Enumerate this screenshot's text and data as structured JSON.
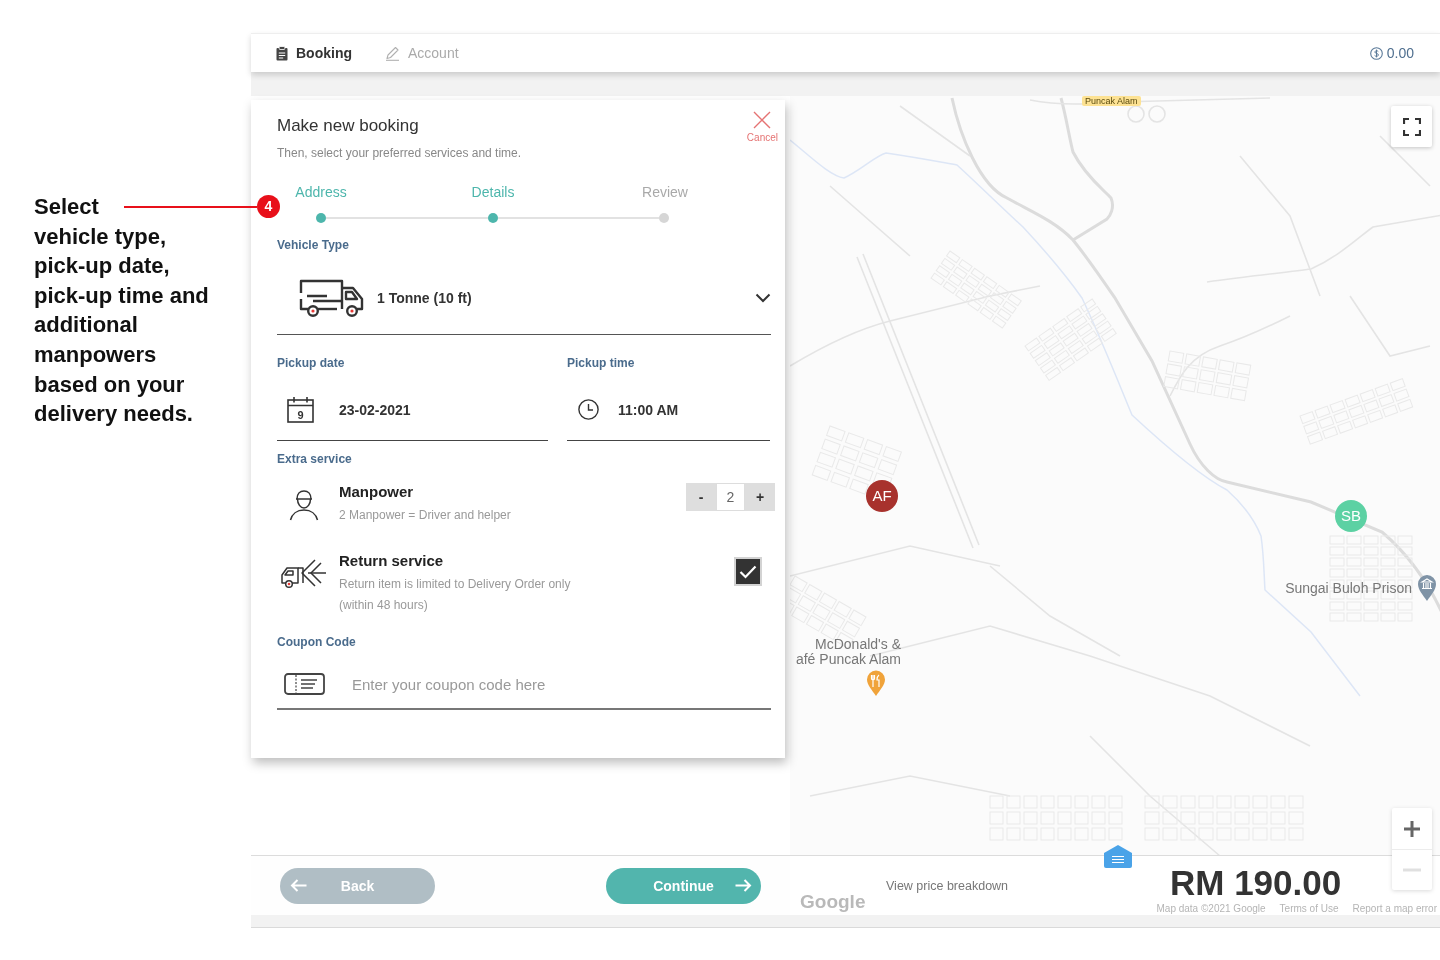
{
  "annotation": {
    "lead": "Select",
    "text": "vehicle type, pick-up date, pick-up time and additional manpowers based on your delivery needs.",
    "step": "4"
  },
  "nav": {
    "tabs": [
      {
        "label": "Booking",
        "selected": true
      },
      {
        "label": "Account",
        "selected": false
      }
    ],
    "balance": "0.00"
  },
  "booking": {
    "title": "Make new booking",
    "subtitle": "Then, select your preferred services and time.",
    "cancel": "Cancel",
    "steps": [
      {
        "label": "Address",
        "completed": true
      },
      {
        "label": "Details",
        "completed": true
      },
      {
        "label": "Review",
        "completed": false
      }
    ],
    "vehicle": {
      "label": "Vehicle Type",
      "value": "1 Tonne (10 ft)"
    },
    "pickup_date": {
      "label": "Pickup date",
      "value": "23-02-2021",
      "calendar_day": "9"
    },
    "pickup_time": {
      "label": "Pickup time",
      "value": "11:00 AM"
    },
    "extra_service": {
      "label": "Extra service",
      "items": [
        {
          "kind": "counter",
          "title": "Manpower",
          "description": [
            "2 Manpower = Driver and helper"
          ],
          "decrement": "-",
          "value": "2",
          "increment": "+"
        },
        {
          "kind": "checkbox",
          "title": "Return service",
          "description": [
            "Return item is limited to Delivery Order only",
            "(within 48 hours)"
          ],
          "checked": true
        }
      ]
    },
    "coupon": {
      "label": "Coupon Code",
      "placeholder": "Enter your coupon code here"
    }
  },
  "map": {
    "road_label": "Puncak Alam",
    "markers": [
      {
        "label": "AF",
        "color": "#a8322d"
      },
      {
        "label": "SB",
        "color": "#5cd1a3"
      }
    ],
    "places": [
      {
        "kind": "landmark",
        "lines": [
          "Sungai Buloh Prison"
        ]
      },
      {
        "kind": "restaurant",
        "lines": [
          "McDonald's &",
          "afé Puncak Alam"
        ]
      }
    ],
    "logo": "Google",
    "attribution": [
      "Map data ©2021 Google",
      "Terms of Use",
      "Report a map error"
    ]
  },
  "footer": {
    "back": "Back",
    "continue": "Continue",
    "price_link": "View price breakdown",
    "price": "RM 190.00"
  }
}
